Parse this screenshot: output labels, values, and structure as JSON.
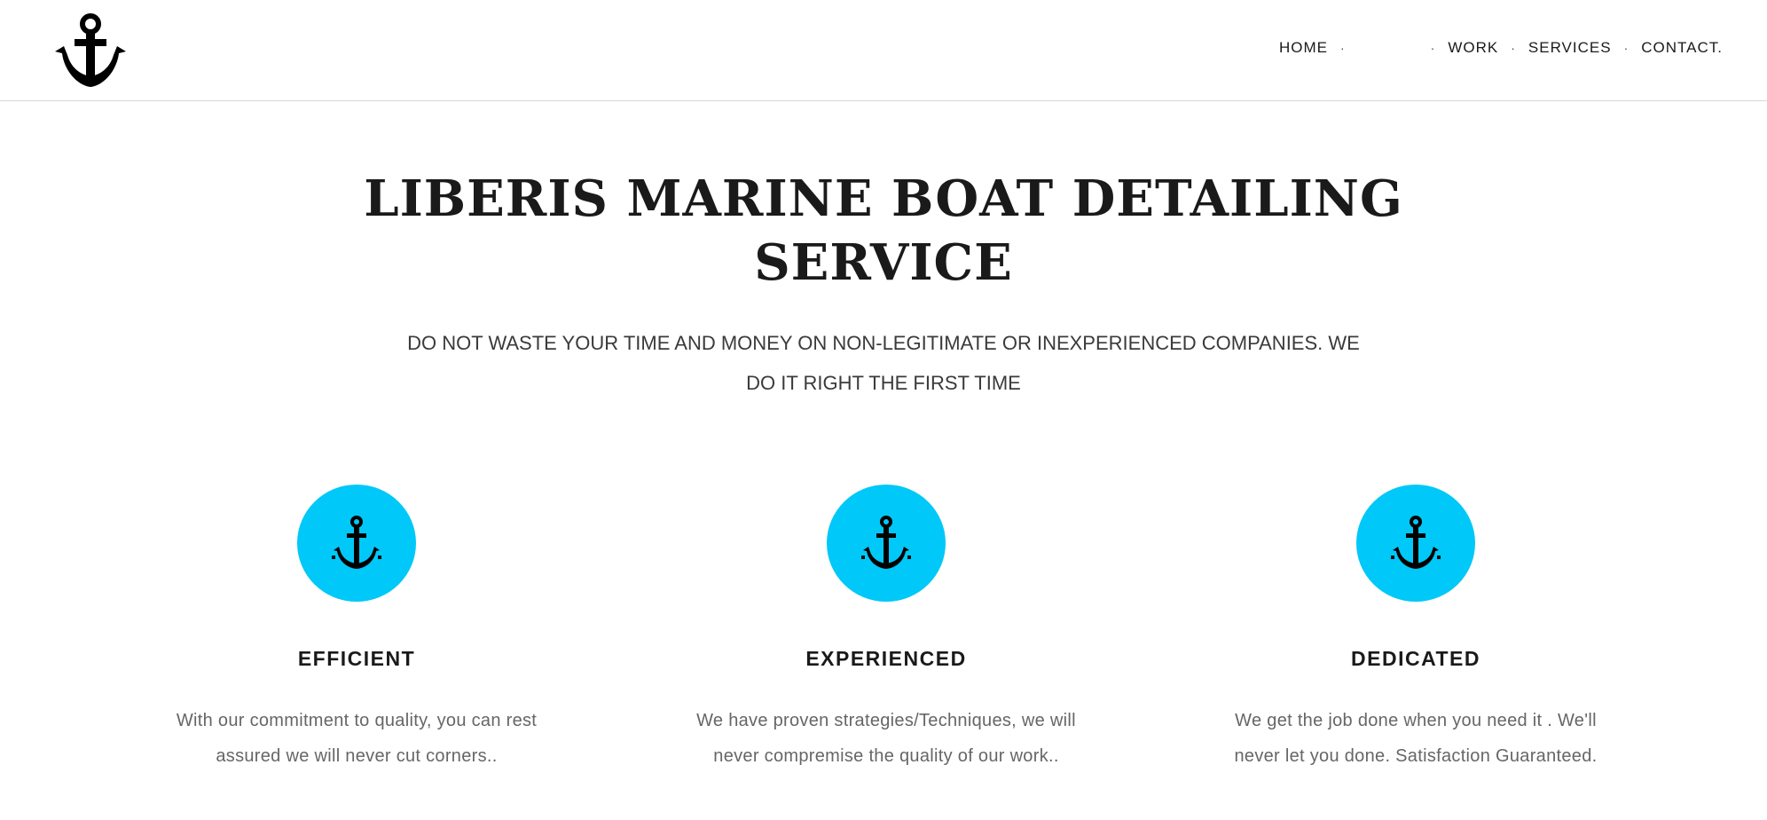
{
  "header": {
    "logo_icon": "anchor-icon",
    "nav": {
      "home": "HOME",
      "about": "",
      "work": "WORK",
      "services": "SERVICES",
      "contact": "CONTACT.",
      "separator": "·"
    }
  },
  "hero": {
    "title_line1": "LIBERIS MARINE BOAT DETAILING",
    "title_line2": "SERVICE",
    "subtitle_line1": "DO NOT WASTE YOUR TIME AND MONEY ON NON-LEGITIMATE OR INEXPERIENCED COMPANIES. WE",
    "subtitle_line2": "DO IT RIGHT THE FIRST TIME"
  },
  "features": [
    {
      "icon": "anchor-icon",
      "title": "EFFICIENT",
      "text_line1": "With our commitment to quality, you can rest",
      "text_line2": "assured we will never cut corners.."
    },
    {
      "icon": "anchor-icon",
      "title": "EXPERIENCED",
      "text_line1": "We have proven strategies/Techniques, we will",
      "text_line2": "never compremise the quality of our work.."
    },
    {
      "icon": "anchor-icon",
      "title": "DEDICATED",
      "text_line1": "We get the job done when you need it . We'll",
      "text_line2": "never let you done. Satisfaction Guaranteed."
    }
  ],
  "colors": {
    "accent": "#00c8f8",
    "text": "#1a1a1a",
    "muted": "#666666"
  }
}
